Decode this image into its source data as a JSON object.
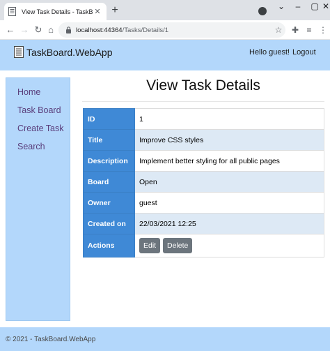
{
  "browser": {
    "tab_title": "View Task Details - TaskBoard",
    "url_host": "localhost:44364",
    "url_path": "/Tasks/Details/1"
  },
  "header": {
    "brand": "TaskBoard.WebApp",
    "greeting": "Hello guest!",
    "logout": "Logout"
  },
  "sidebar": {
    "items": [
      {
        "label": "Home"
      },
      {
        "label": "Task Board"
      },
      {
        "label": "Create Task"
      },
      {
        "label": "Search"
      }
    ]
  },
  "main": {
    "title": "View Task Details",
    "rows": [
      {
        "key": "ID",
        "value": "1"
      },
      {
        "key": "Title",
        "value": "Improve CSS styles"
      },
      {
        "key": "Description",
        "value": "Implement better styling for all public pages"
      },
      {
        "key": "Board",
        "value": "Open"
      },
      {
        "key": "Owner",
        "value": "guest"
      },
      {
        "key": "Created on",
        "value": "22/03/2021 12:25"
      }
    ],
    "actions_label": "Actions",
    "edit_label": "Edit",
    "delete_label": "Delete"
  },
  "footer": {
    "text": "© 2021 - TaskBoard.WebApp"
  },
  "colors": {
    "header_bg": "#b3d7fb",
    "key_cell_bg": "#3f89d6",
    "stripe_bg": "#dde9f5",
    "button_bg": "#6c757d",
    "link_color": "#5a3e7c"
  },
  "icons": {
    "tab_favicon": "document-icon",
    "brand": "document-icon"
  }
}
